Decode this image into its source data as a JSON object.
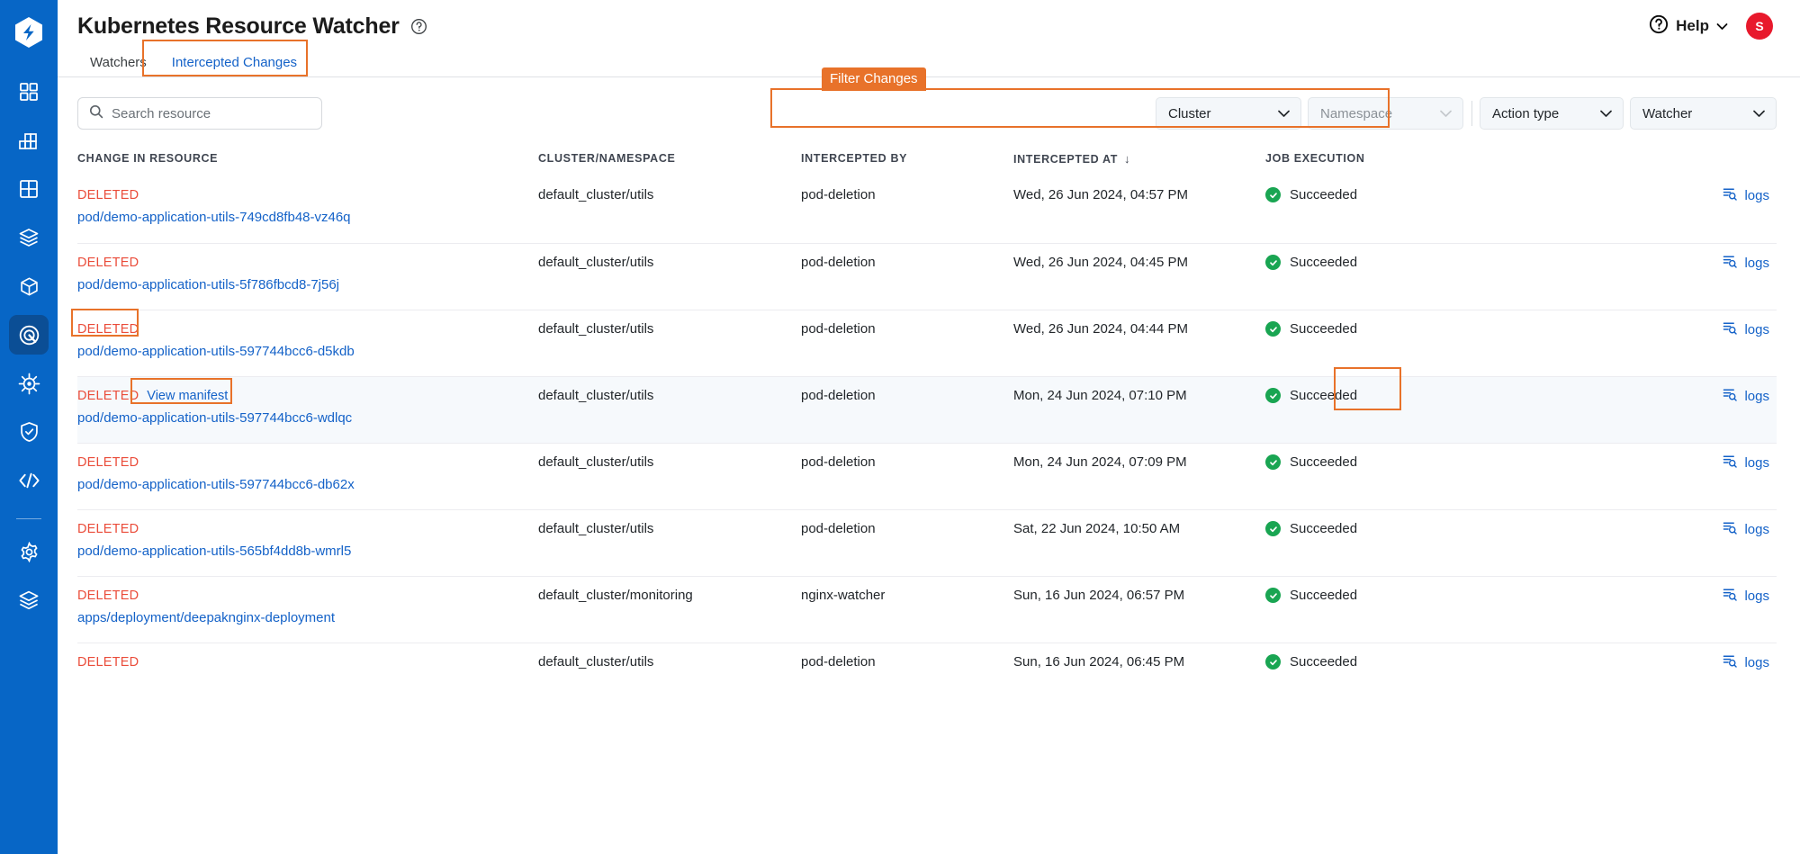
{
  "sidebar": {
    "logo_icon": "harness-logo-icon",
    "items": [
      {
        "icon": "dashboard-grid-icon",
        "name": "sidebar-item-dashboards",
        "active": false
      },
      {
        "icon": "bar-chart-grid-icon",
        "name": "sidebar-item-builds",
        "active": false
      },
      {
        "icon": "table-grid-icon",
        "name": "sidebar-item-deployments",
        "active": false
      },
      {
        "icon": "open-box-icon",
        "name": "sidebar-item-packages",
        "active": false
      },
      {
        "icon": "cube-icon",
        "name": "sidebar-item-environments",
        "active": false
      },
      {
        "icon": "target-ring-icon",
        "name": "sidebar-item-chaos",
        "active": true
      },
      {
        "icon": "helm-wheel-icon",
        "name": "sidebar-item-kubernetes",
        "active": false
      },
      {
        "icon": "shield-check-icon",
        "name": "sidebar-item-security",
        "active": false
      },
      {
        "icon": "code-brackets-icon",
        "name": "sidebar-item-code",
        "active": false
      }
    ],
    "bottom_items": [
      {
        "icon": "gear-icon",
        "name": "sidebar-item-settings",
        "active": false
      },
      {
        "icon": "layers-icon",
        "name": "sidebar-item-projects",
        "active": false
      }
    ]
  },
  "header": {
    "title": "Kubernetes Resource Watcher",
    "title_help_icon": "question-circle-icon",
    "help_label": "Help",
    "help_icon": "question-circle-icon",
    "help_chevron_icon": "chevron-down-icon",
    "avatar_initial": "S"
  },
  "tabs": [
    {
      "label": "Watchers",
      "active": false
    },
    {
      "label": "Intercepted Changes",
      "active": true
    }
  ],
  "search": {
    "placeholder": "Search resource",
    "value": "",
    "icon": "search-icon"
  },
  "filters": {
    "annotation_label": "Filter Changes",
    "items": [
      {
        "label": "Cluster",
        "is_placeholder": false,
        "name": "filter-cluster"
      },
      {
        "label": "Namespace",
        "is_placeholder": true,
        "name": "filter-namespace"
      },
      {
        "label": "Action type",
        "is_placeholder": false,
        "name": "filter-action-type"
      },
      {
        "label": "Watcher",
        "is_placeholder": false,
        "name": "filter-watcher"
      }
    ],
    "chevron_icon": "chevron-down-icon"
  },
  "table": {
    "columns": [
      "CHANGE IN RESOURCE",
      "CLUSTER/NAMESPACE",
      "INTERCEPTED BY",
      "INTERCEPTED AT",
      "JOB EXECUTION"
    ],
    "sort_icon": "arrow-down-icon",
    "logs_label": "logs",
    "logs_icon": "logs-search-icon",
    "status_icon": "check-circle-icon",
    "view_manifest_label": "View manifest",
    "rows": [
      {
        "action": "DELETED",
        "resource": "pod/demo-application-utils-749cd8fb48-vz46q",
        "cluster_namespace": "default_cluster/utils",
        "intercepted_by": "pod-deletion",
        "intercepted_at": "Wed, 26 Jun 2024, 04:57 PM",
        "job_execution": "Succeeded",
        "highlight": false,
        "show_manifest": false
      },
      {
        "action": "DELETED",
        "resource": "pod/demo-application-utils-5f786fbcd8-7j56j",
        "cluster_namespace": "default_cluster/utils",
        "intercepted_by": "pod-deletion",
        "intercepted_at": "Wed, 26 Jun 2024, 04:45 PM",
        "job_execution": "Succeeded",
        "highlight": false,
        "show_manifest": false
      },
      {
        "action": "DELETED",
        "resource": "pod/demo-application-utils-597744bcc6-d5kdb",
        "cluster_namespace": "default_cluster/utils",
        "intercepted_by": "pod-deletion",
        "intercepted_at": "Wed, 26 Jun 2024, 04:44 PM",
        "job_execution": "Succeeded",
        "highlight": false,
        "show_manifest": false
      },
      {
        "action": "DELETED",
        "resource": "pod/demo-application-utils-597744bcc6-wdlqc",
        "cluster_namespace": "default_cluster/utils",
        "intercepted_by": "pod-deletion",
        "intercepted_at": "Mon, 24 Jun 2024, 07:10 PM",
        "job_execution": "Succeeded",
        "highlight": true,
        "show_manifest": true
      },
      {
        "action": "DELETED",
        "resource": "pod/demo-application-utils-597744bcc6-db62x",
        "cluster_namespace": "default_cluster/utils",
        "intercepted_by": "pod-deletion",
        "intercepted_at": "Mon, 24 Jun 2024, 07:09 PM",
        "job_execution": "Succeeded",
        "highlight": false,
        "show_manifest": false
      },
      {
        "action": "DELETED",
        "resource": "pod/demo-application-utils-565bf4dd8b-wmrl5",
        "cluster_namespace": "default_cluster/utils",
        "intercepted_by": "pod-deletion",
        "intercepted_at": "Sat, 22 Jun 2024, 10:50 AM",
        "job_execution": "Succeeded",
        "highlight": false,
        "show_manifest": false
      },
      {
        "action": "DELETED",
        "resource": "apps/deployment/deepaknginx-deployment",
        "cluster_namespace": "default_cluster/monitoring",
        "intercepted_by": "nginx-watcher",
        "intercepted_at": "Sun, 16 Jun 2024, 06:57 PM",
        "job_execution": "Succeeded",
        "highlight": false,
        "show_manifest": false
      },
      {
        "action": "DELETED",
        "resource": "",
        "cluster_namespace": "default_cluster/utils",
        "intercepted_by": "pod-deletion",
        "intercepted_at": "Sun, 16 Jun 2024, 06:45 PM",
        "job_execution": "Succeeded",
        "highlight": false,
        "show_manifest": false
      }
    ]
  },
  "annotations": {
    "tab_highlight": "Intercepted Changes",
    "filter_highlight": "Filter Changes",
    "deleted_highlight": "DELETED",
    "view_manifest_highlight": "View manifest",
    "logs_highlight": "logs",
    "color": "#E8722A"
  }
}
